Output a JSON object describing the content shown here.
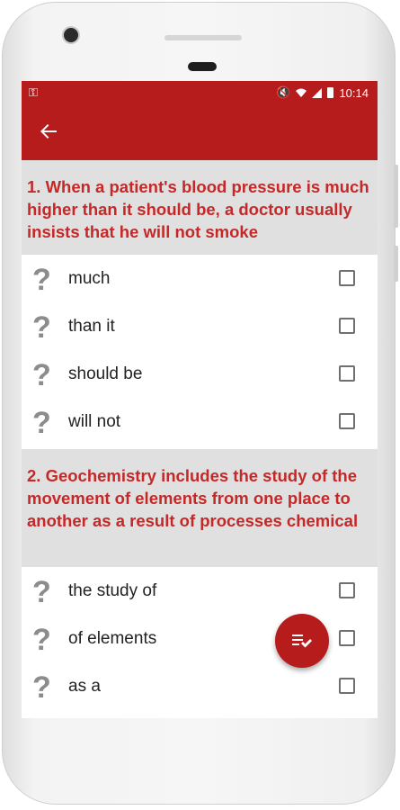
{
  "status_bar": {
    "time": "10:14",
    "left_icon": "key-icon",
    "right_icons": [
      "mute-icon",
      "wifi-icon",
      "signal-icon",
      "battery-icon"
    ]
  },
  "app_bar": {
    "back_icon": "arrow-back-icon",
    "color": "#b71c1c"
  },
  "questions": [
    {
      "text": "1. When a patient's blood pressure is much higher than it should be, a doctor usually insists that he will not smoke",
      "options": [
        "much",
        "than it",
        "should be",
        "will not"
      ]
    },
    {
      "text": "2. Geochemistry includes the study of the movement of elements from one place to another as a result of processes chemical",
      "options": [
        "the study of",
        "of elements",
        "as a"
      ]
    }
  ],
  "fab": {
    "icon": "playlist-check-icon"
  },
  "colors": {
    "accent": "#c62828",
    "question_bg": "#e0e0e0",
    "icon_grey": "#8c8c8c"
  }
}
